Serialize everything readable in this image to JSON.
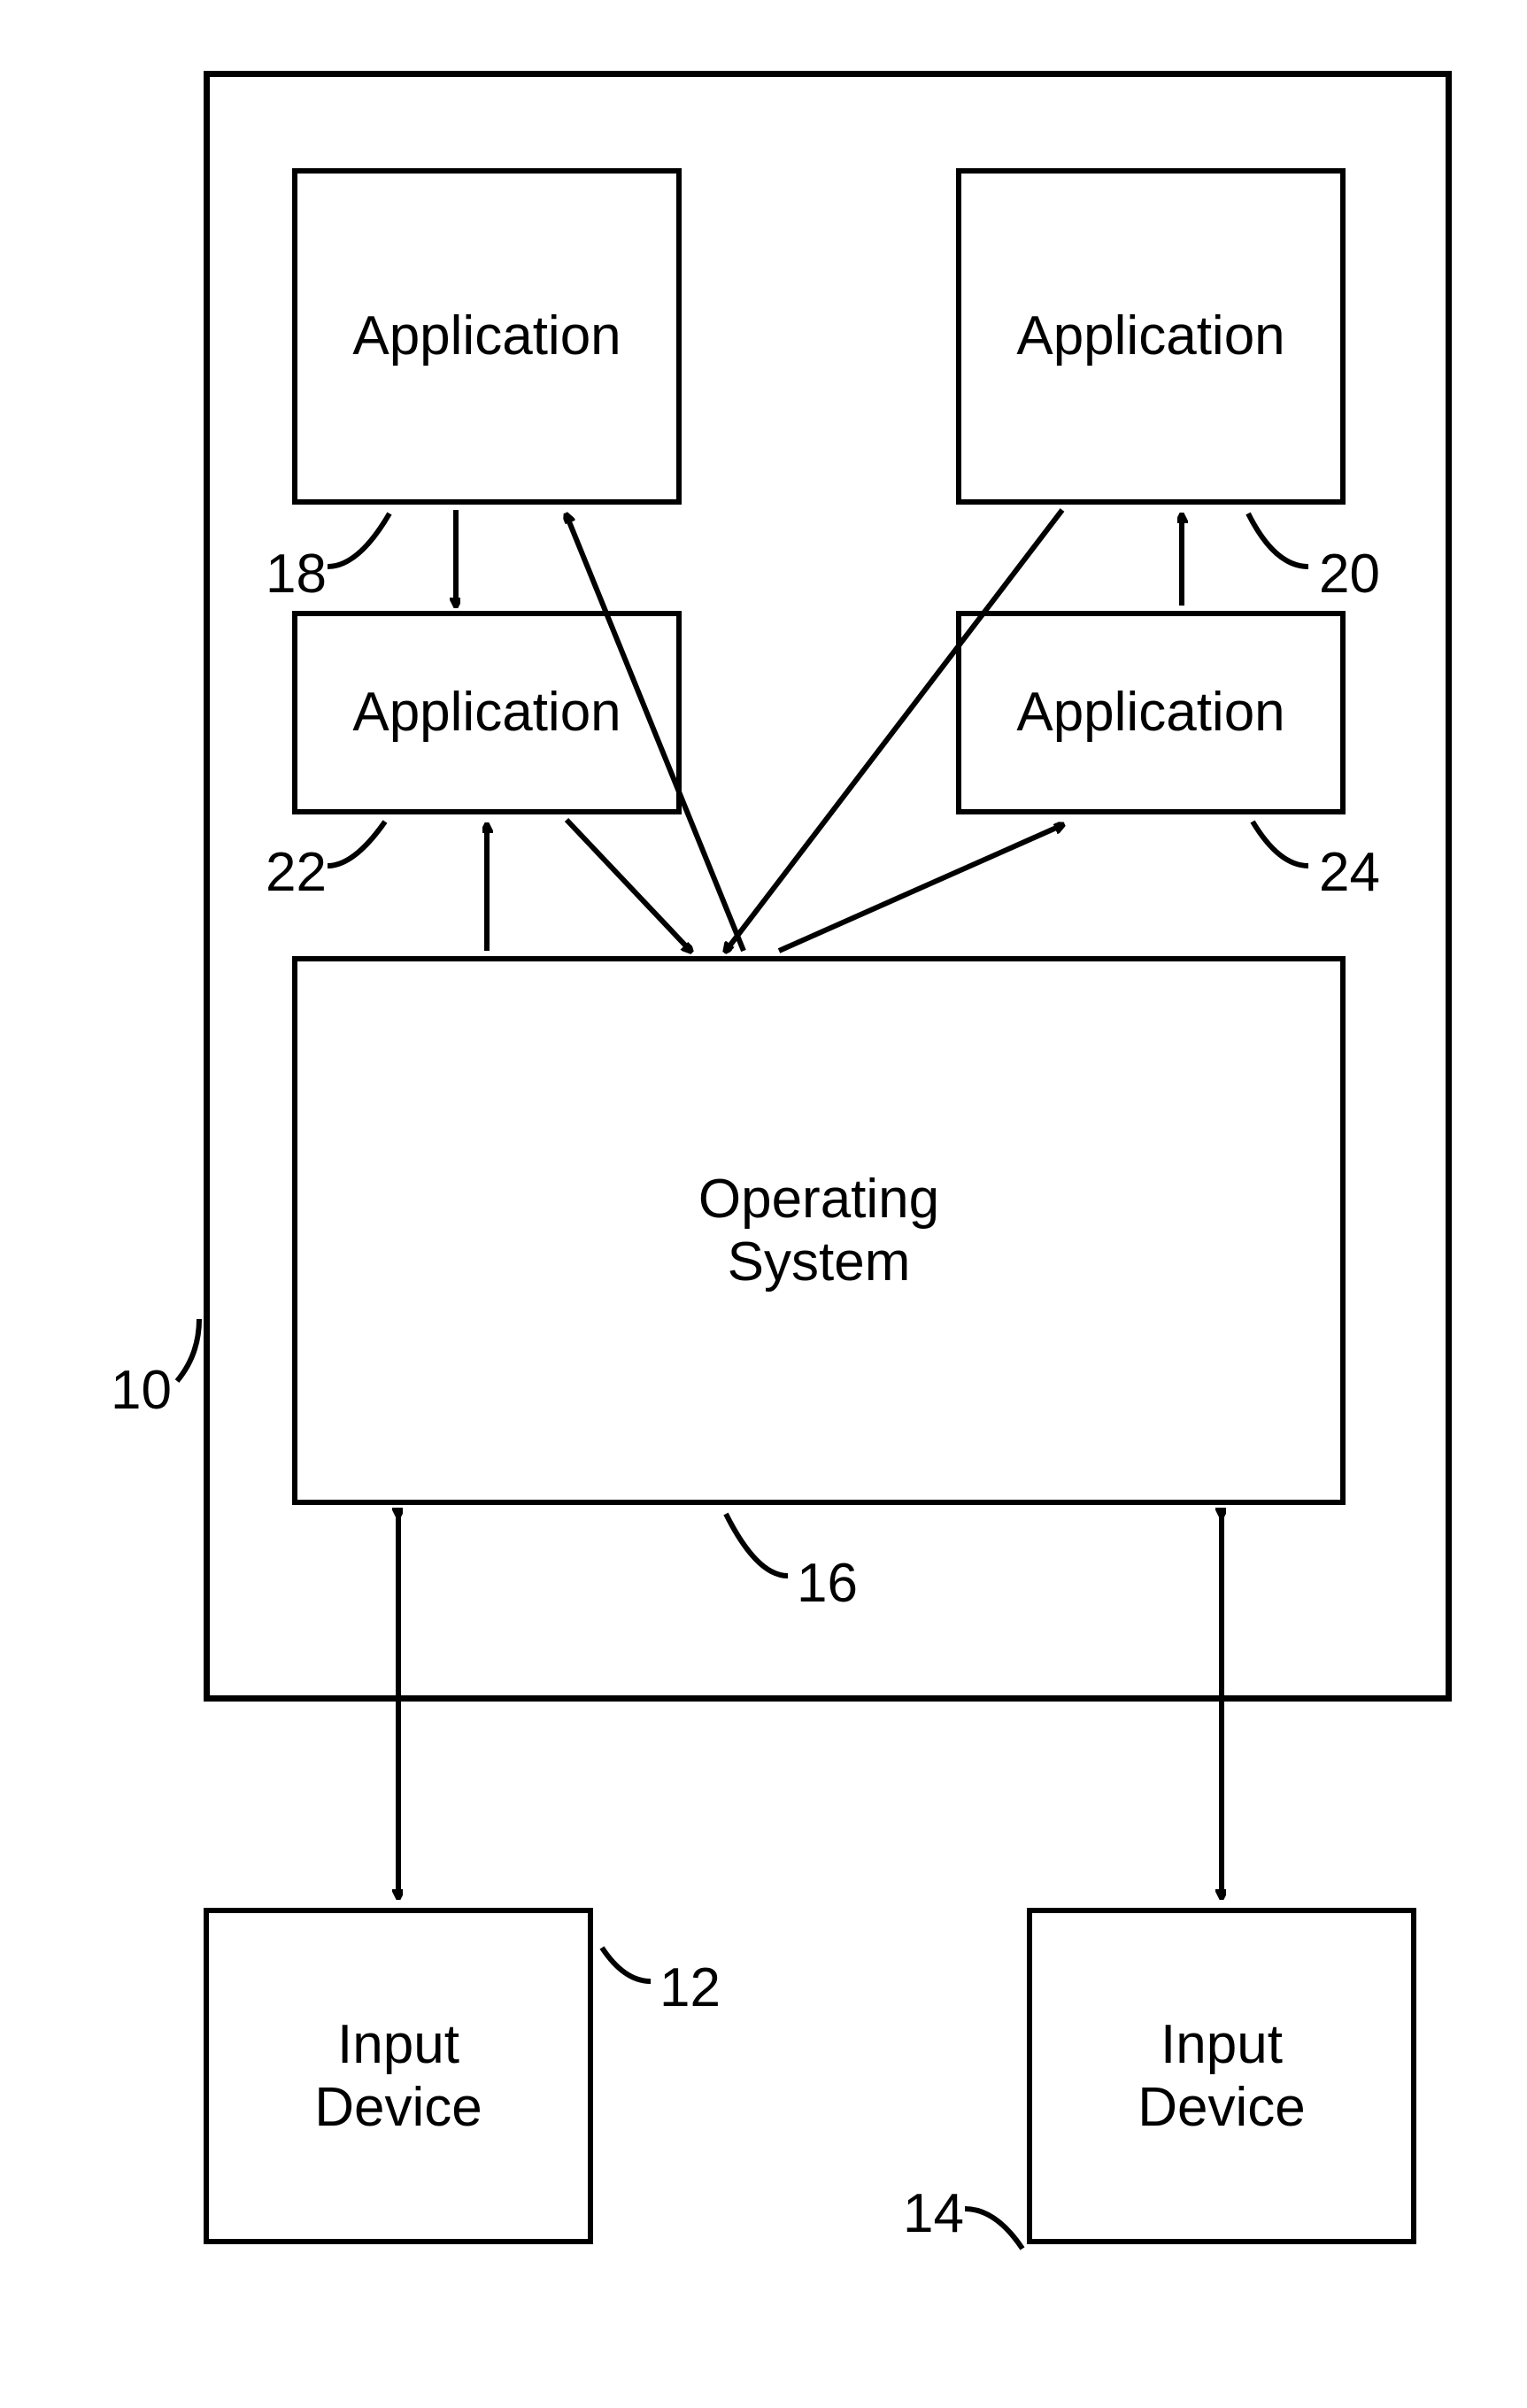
{
  "boxes": {
    "app18": "Application",
    "app20": "Application",
    "app22": "Application",
    "app24": "Application",
    "os": "Operating\nSystem",
    "in12": "Input\nDevice",
    "in14": "Input\nDevice"
  },
  "labels": {
    "n10": "10",
    "n12": "12",
    "n14": "14",
    "n16": "16",
    "n18": "18",
    "n20": "20",
    "n22": "22",
    "n24": "24"
  }
}
